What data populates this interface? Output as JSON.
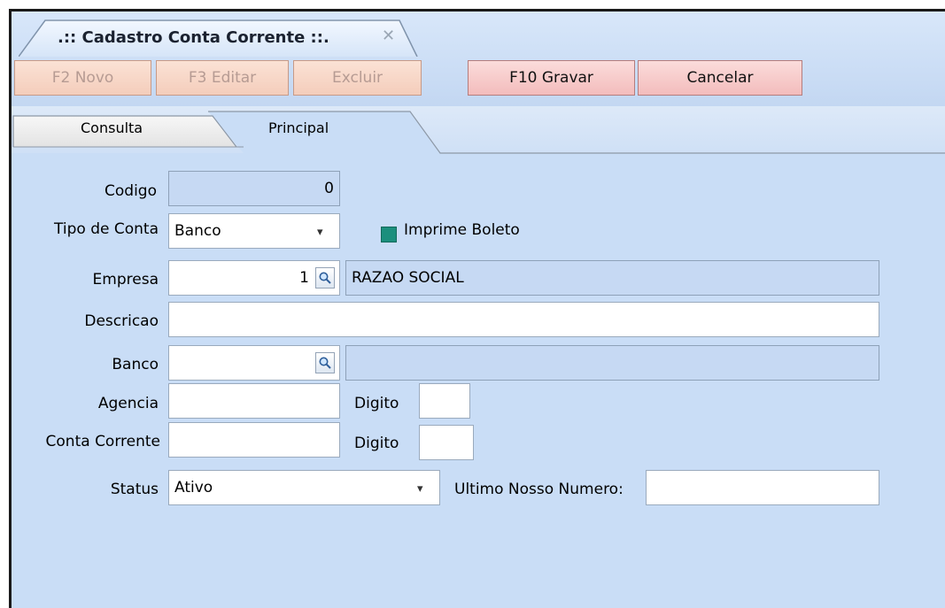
{
  "window": {
    "title": ".:: Cadastro Conta Corrente ::."
  },
  "toolbar": {
    "novo": "F2 Novo",
    "editar": "F3 Editar",
    "excluir": "Excluir",
    "gravar": "F10 Gravar",
    "cancelar": "Cancelar"
  },
  "tabs": {
    "consulta": "Consulta",
    "principal": "Principal"
  },
  "form": {
    "codigo": {
      "label": "Codigo",
      "value": "0"
    },
    "tipo_conta": {
      "label": "Tipo de Conta",
      "value": "Banco"
    },
    "imprime_boleto": {
      "label": "Imprime Boleto",
      "checked": true
    },
    "empresa": {
      "label": "Empresa",
      "value": "1",
      "description": "RAZAO SOCIAL"
    },
    "descricao": {
      "label": "Descricao",
      "value": ""
    },
    "banco": {
      "label": "Banco",
      "value": "",
      "description": ""
    },
    "agencia": {
      "label": "Agencia",
      "value": "",
      "digito_label": "Digito",
      "digito": ""
    },
    "conta_corrente": {
      "label": "Conta Corrente",
      "value": "",
      "digito_label": "Digito",
      "digito": ""
    },
    "status": {
      "label": "Status",
      "value": "Ativo"
    },
    "ultimo_nosso_numero": {
      "label": "Ultimo Nosso Numero:",
      "value": ""
    }
  },
  "colors": {
    "background": "#c9ddf6",
    "button_disabled": "#f4cdbb",
    "button_active": "#f3bcbc",
    "checkbox": "#1b8f7d"
  }
}
